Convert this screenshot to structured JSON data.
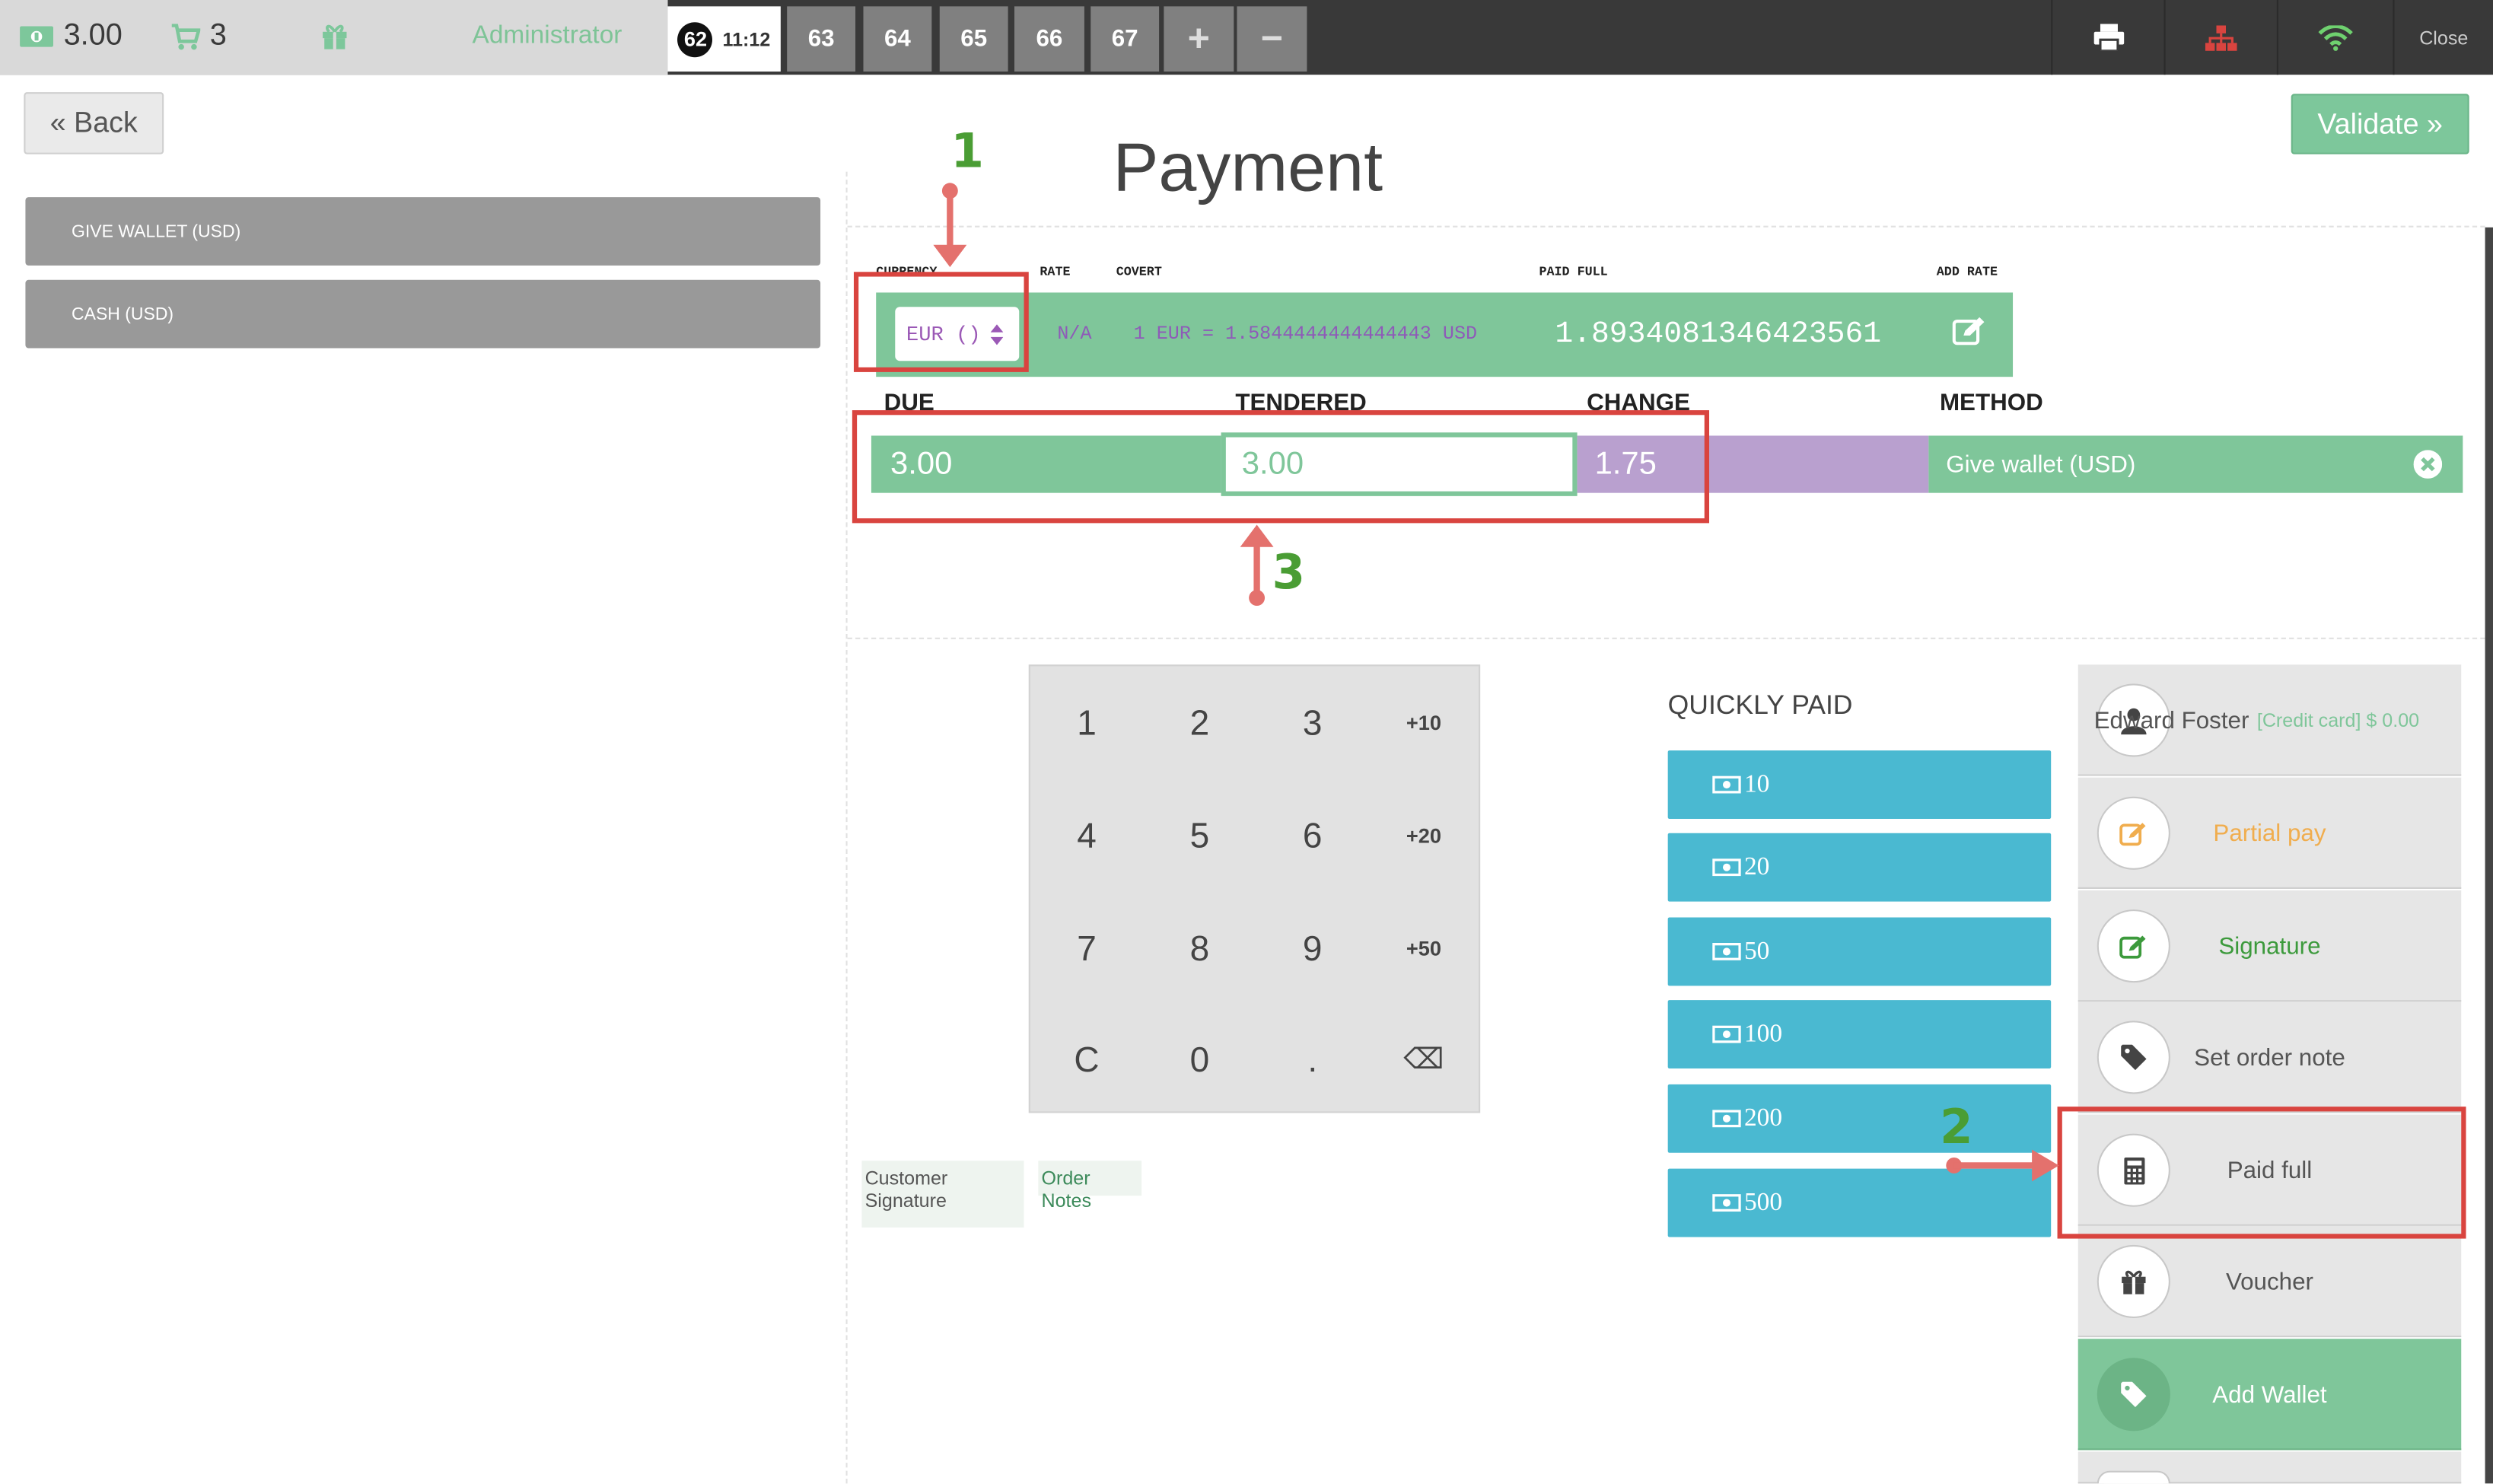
{
  "topbar": {
    "amount": "3.00",
    "cart_count": "3",
    "user": "Administrator",
    "active_order": {
      "number": "62",
      "time": "11:12"
    },
    "order_tabs": [
      "63",
      "64",
      "65",
      "66",
      "67"
    ],
    "add_tab": "+",
    "remove_tab": "−",
    "close_label": "Close"
  },
  "back_label": "« Back",
  "payment_methods": [
    "GIVE WALLET (USD)",
    "CASH (USD)"
  ],
  "title": "Payment",
  "validate_label": "Validate »",
  "rate_table": {
    "headers": {
      "currency": "CURRENCY",
      "rate": "RATE",
      "covert": "COVERT",
      "paid_full": "PAID FULL",
      "add_rate": "ADD RATE"
    },
    "currency": "EUR ()",
    "rate": "N/A",
    "covert": "1 EUR = 1.5844444444444443 USD",
    "paid_full": "1.8934081346423561"
  },
  "payment_line": {
    "headers": {
      "due": "DUE",
      "tendered": "TENDERED",
      "change": "CHANGE",
      "method": "METHOD"
    },
    "due": "3.00",
    "tendered": "3.00",
    "change": "1.75",
    "method": "Give wallet (USD)"
  },
  "numpad": {
    "keys": [
      "1",
      "2",
      "3",
      "+10",
      "4",
      "5",
      "6",
      "+20",
      "7",
      "8",
      "9",
      "+50",
      "C",
      "0",
      ".",
      "⌫"
    ]
  },
  "quickly_paid": {
    "title": "QUICKLY PAID",
    "amounts": [
      "10",
      "20",
      "50",
      "100",
      "200",
      "500"
    ]
  },
  "customer": {
    "name": "Edward Foster",
    "credit": "[Credit card] $ 0.00"
  },
  "actions": [
    {
      "label": "Partial pay",
      "color": "#f0ad4e"
    },
    {
      "label": "Signature",
      "color": "#3c9a3c"
    },
    {
      "label": "Set order note",
      "color": "#555555"
    },
    {
      "label": "Paid full",
      "color": "#555555"
    },
    {
      "label": "Voucher",
      "color": "#555555"
    },
    {
      "label": "Add Wallet",
      "color": "#ffffff"
    }
  ],
  "chips": {
    "signature": "Customer Signature",
    "notes": "Order Notes"
  },
  "annotations": [
    "1",
    "2",
    "3"
  ],
  "colors": {
    "green": "#7fc69a",
    "purple": "#b9a0cf",
    "blue": "#4ab9d1",
    "red": "#d9443f",
    "anno_green": "#4a9d34"
  }
}
